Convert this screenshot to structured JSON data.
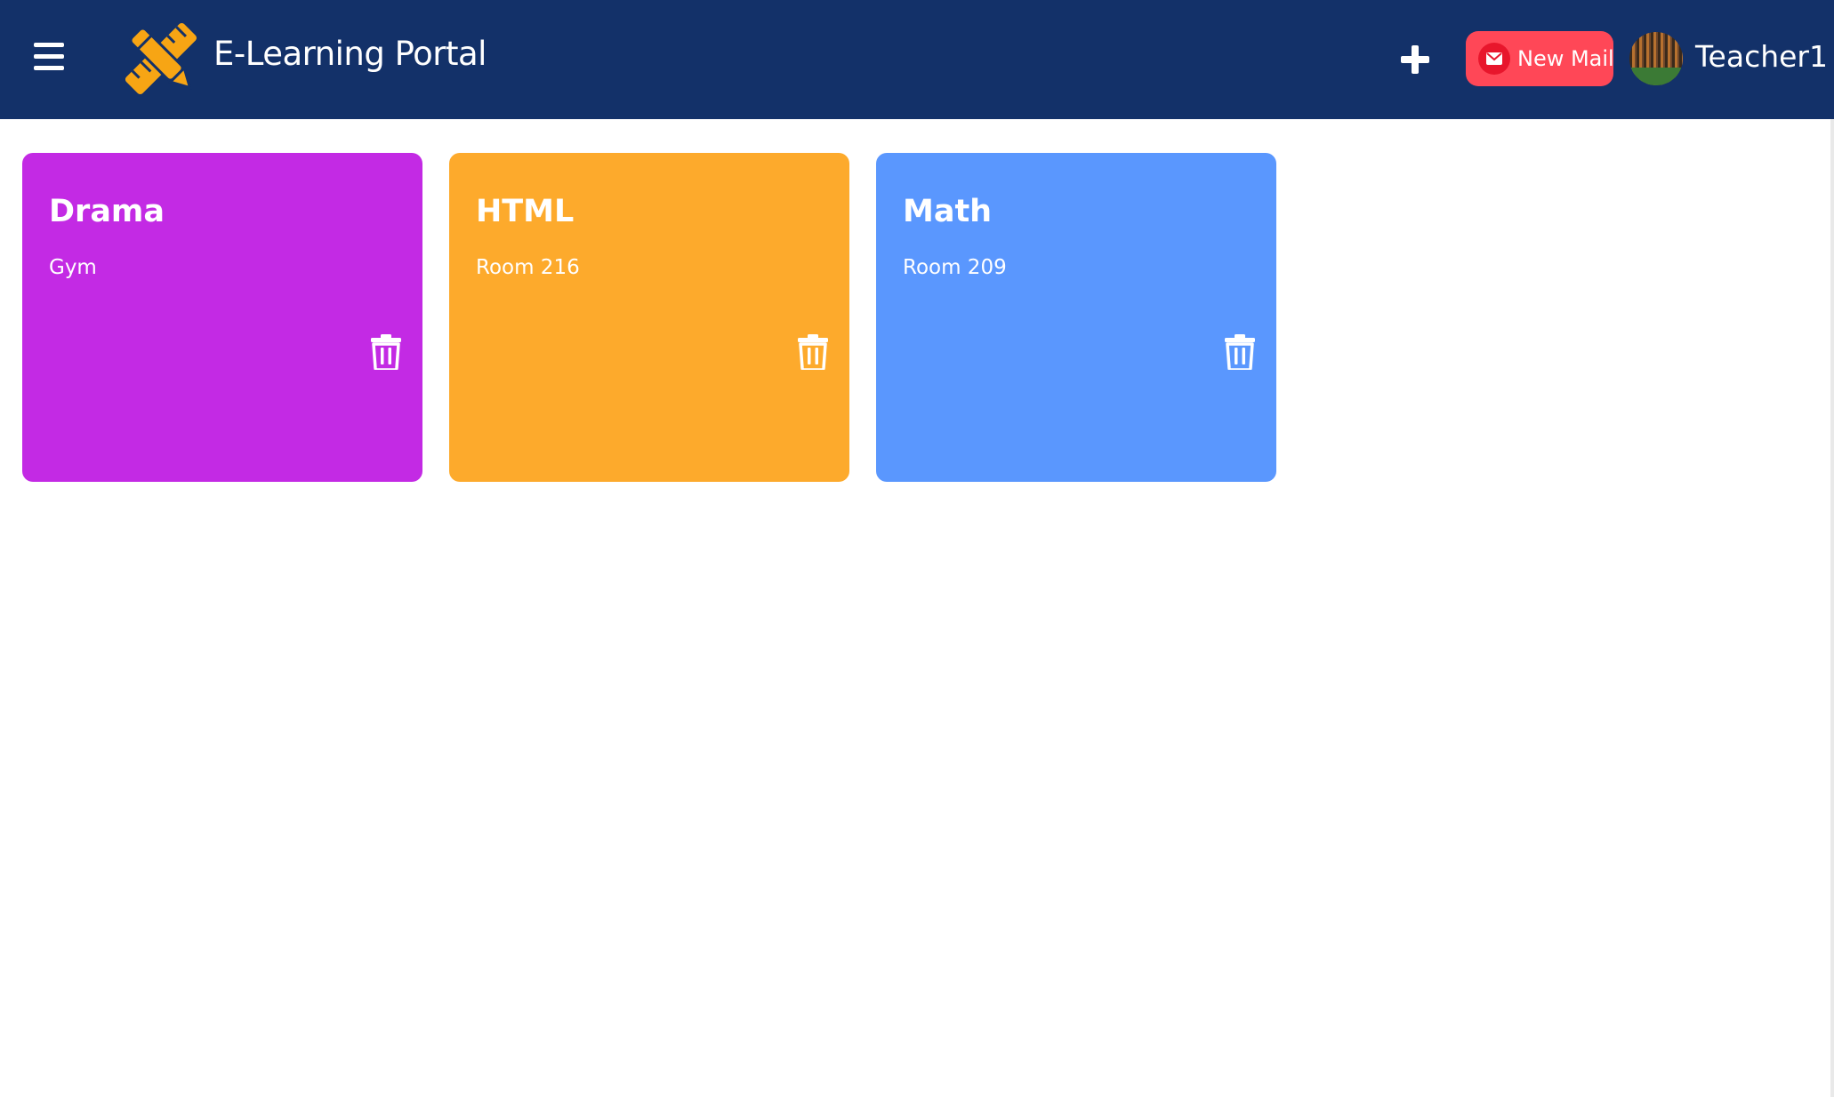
{
  "header": {
    "title": "E-Learning Portal",
    "menu_icon": "hamburger-menu-icon",
    "logo_icon": "pencil-ruler-icon",
    "add_icon": "plus-icon",
    "mail": {
      "label": "New Mail",
      "icon": "envelope-icon"
    },
    "user": {
      "name": "Teacher1",
      "avatar": "forest-avatar"
    },
    "background_color": "#133169"
  },
  "classes": [
    {
      "name": "Drama",
      "room": "Gym",
      "color": "#c32ae4",
      "action_icon": "trash-icon"
    },
    {
      "name": "HTML",
      "room": "Room 216",
      "color": "#fdaa2c",
      "action_icon": "trash-icon"
    },
    {
      "name": "Math",
      "room": "Room 209",
      "color": "#5a97fe",
      "action_icon": "trash-icon"
    }
  ],
  "accent_colors": {
    "logo": "#f7a514",
    "mail_button": "#ff4757"
  }
}
